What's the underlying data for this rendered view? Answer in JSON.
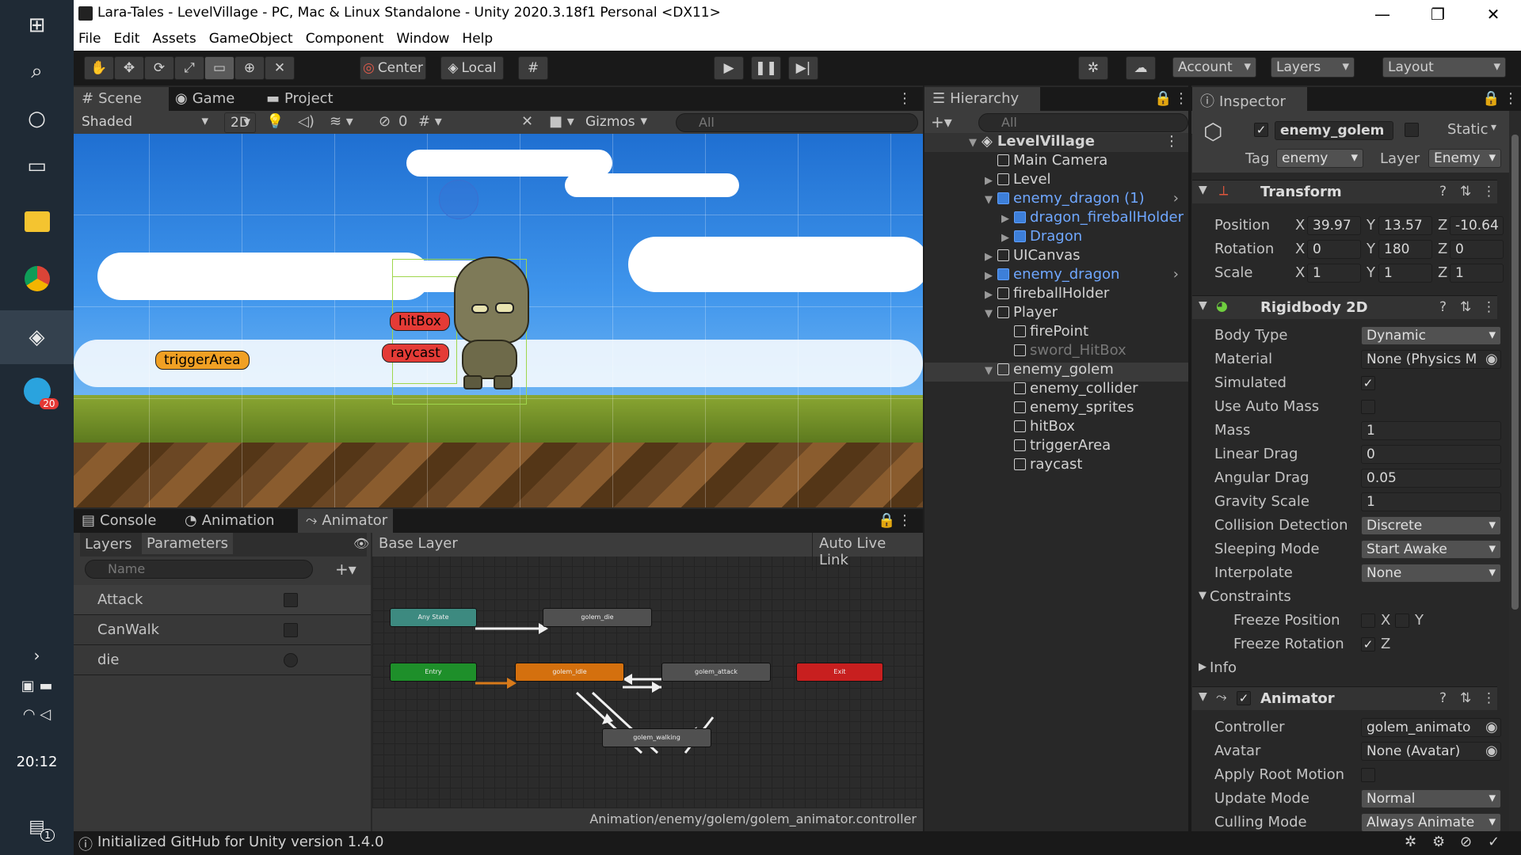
{
  "taskbar": {
    "clock": "20:12",
    "telegram_badge": "20",
    "notifications_badge": "1"
  },
  "window": {
    "title": "Lara-Tales - LevelVillage - PC, Mac & Linux Standalone - Unity 2020.3.18f1 Personal <DX11>"
  },
  "menu": [
    "File",
    "Edit",
    "Assets",
    "GameObject",
    "Component",
    "Window",
    "Help"
  ],
  "toolbar": {
    "center_label": "Center",
    "local_label": "Local",
    "account_label": "Account",
    "layers_label": "Layers",
    "layout_label": "Layout"
  },
  "scene_panel": {
    "tabs": [
      "Scene",
      "Game",
      "Project"
    ],
    "shading": "Shaded",
    "mode_2d": "2D",
    "hidden_count": "0",
    "gizmos": "Gizmos",
    "search_placeholder": "All",
    "labels": {
      "trigger": "triggerArea",
      "hitbox": "hitBox",
      "raycast": "raycast"
    }
  },
  "bottom_panel": {
    "tabs": [
      "Console",
      "Animation",
      "Animator"
    ],
    "subtabs": [
      "Layers",
      "Parameters"
    ],
    "search_placeholder": "Name",
    "base_layer": "Base Layer",
    "auto_live_link": "Auto Live Link",
    "parameters": [
      {
        "name": "Attack",
        "type": "bool"
      },
      {
        "name": "CanWalk",
        "type": "bool"
      },
      {
        "name": "die",
        "type": "trigger"
      }
    ],
    "states": {
      "any": "Any State",
      "die": "golem_die",
      "entry": "Entry",
      "idle": "golem_idle",
      "attack": "golem_attack",
      "exit": "Exit",
      "walking": "golem_walking"
    },
    "controller_path": "Animation/enemy/golem/golem_animator.controller"
  },
  "hierarchy": {
    "tab": "Hierarchy",
    "search_placeholder": "All",
    "scene": "LevelVillage",
    "items": [
      {
        "label": "Main Camera",
        "depth": 1,
        "arrow": "",
        "style": "normal"
      },
      {
        "label": "Level",
        "depth": 1,
        "arrow": "▶",
        "style": "normal"
      },
      {
        "label": "enemy_dragon (1)",
        "depth": 1,
        "arrow": "▼",
        "style": "blue"
      },
      {
        "label": "dragon_fireballHolder",
        "depth": 2,
        "arrow": "▶",
        "style": "blue"
      },
      {
        "label": "Dragon",
        "depth": 2,
        "arrow": "▶",
        "style": "blue"
      },
      {
        "label": "UICanvas",
        "depth": 1,
        "arrow": "▶",
        "style": "normal"
      },
      {
        "label": "enemy_dragon",
        "depth": 1,
        "arrow": "▶",
        "style": "blue"
      },
      {
        "label": "fireballHolder",
        "depth": 1,
        "arrow": "▶",
        "style": "normal"
      },
      {
        "label": "Player",
        "depth": 1,
        "arrow": "▼",
        "style": "normal"
      },
      {
        "label": "firePoint",
        "depth": 2,
        "arrow": "",
        "style": "normal"
      },
      {
        "label": "sword_HitBox",
        "depth": 2,
        "arrow": "",
        "style": "dim"
      },
      {
        "label": "enemy_golem",
        "depth": 1,
        "arrow": "▼",
        "style": "selected"
      },
      {
        "label": "enemy_collider",
        "depth": 2,
        "arrow": "",
        "style": "normal"
      },
      {
        "label": "enemy_sprites",
        "depth": 2,
        "arrow": "",
        "style": "normal"
      },
      {
        "label": "hitBox",
        "depth": 2,
        "arrow": "",
        "style": "normal"
      },
      {
        "label": "triggerArea",
        "depth": 2,
        "arrow": "",
        "style": "normal"
      },
      {
        "label": "raycast",
        "depth": 2,
        "arrow": "",
        "style": "normal"
      }
    ]
  },
  "inspector": {
    "tab": "Inspector",
    "object_name": "enemy_golem",
    "static_label": "Static",
    "tag_label": "Tag",
    "tag_value": "enemy",
    "layer_label": "Layer",
    "layer_value": "Enemy",
    "transform": {
      "title": "Transform",
      "position_label": "Position",
      "position": [
        "39.97",
        "13.57",
        "-10.64"
      ],
      "rotation_label": "Rotation",
      "rotation": [
        "0",
        "180",
        "0"
      ],
      "scale_label": "Scale",
      "scale": [
        "1",
        "1",
        "1"
      ]
    },
    "rigidbody": {
      "title": "Rigidbody 2D",
      "body_type_label": "Body Type",
      "body_type": "Dynamic",
      "material_label": "Material",
      "material": "None (Physics M",
      "simulated_label": "Simulated",
      "use_auto_mass_label": "Use Auto Mass",
      "mass_label": "Mass",
      "mass": "1",
      "linear_drag_label": "Linear Drag",
      "linear_drag": "0",
      "angular_drag_label": "Angular Drag",
      "angular_drag": "0.05",
      "gravity_label": "Gravity Scale",
      "gravity": "1",
      "collision_label": "Collision Detection",
      "collision": "Discrete",
      "sleeping_label": "Sleeping Mode",
      "sleeping": "Start Awake",
      "interpolate_label": "Interpolate",
      "interpolate": "None",
      "constraints_label": "Constraints",
      "freeze_pos_label": "Freeze Position",
      "freeze_rot_label": "Freeze Rotation",
      "info_label": "Info"
    },
    "animator": {
      "title": "Animator",
      "controller_label": "Controller",
      "controller": "golem_animato",
      "avatar_label": "Avatar",
      "avatar": "None (Avatar)",
      "root_motion_label": "Apply Root Motion",
      "update_mode_label": "Update Mode",
      "update_mode": "Normal",
      "culling_label": "Culling Mode",
      "culling": "Always Animate"
    }
  },
  "status": {
    "message": "Initialized GitHub for Unity version 1.4.0"
  }
}
